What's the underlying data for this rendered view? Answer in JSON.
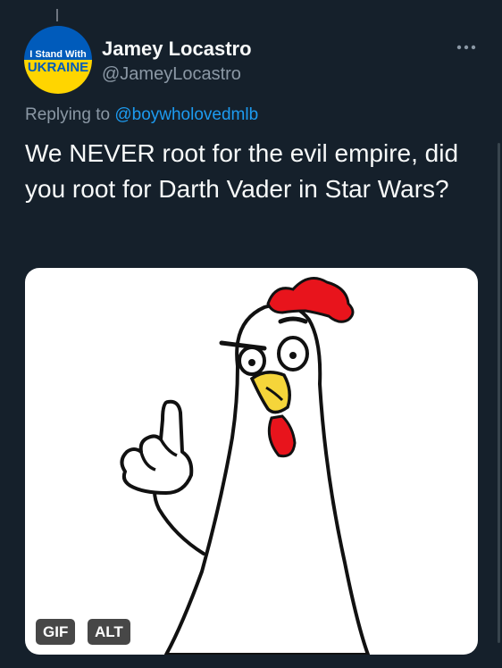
{
  "tweet": {
    "author": {
      "display_name": "Jamey Locastro",
      "handle": "@JameyLocastro",
      "avatar": {
        "line1": "I Stand With",
        "line2": "UKRAINE",
        "colors": {
          "top": "#005bbb",
          "bottom": "#ffd500"
        }
      }
    },
    "more_icon": "ellipsis-icon",
    "replying": {
      "prefix": "Replying to",
      "mention": "@boywholovedmlb"
    },
    "text": "We NEVER root for the evil empire, did you root for Darth Vader in Star Wars?",
    "media": {
      "gif_badge": "GIF",
      "alt_badge": "ALT"
    }
  },
  "colors": {
    "background": "#15202b",
    "text": "#f7f9f9",
    "secondary_text": "#8b98a5",
    "link": "#1d9bf0",
    "comb": "#e8141c"
  }
}
